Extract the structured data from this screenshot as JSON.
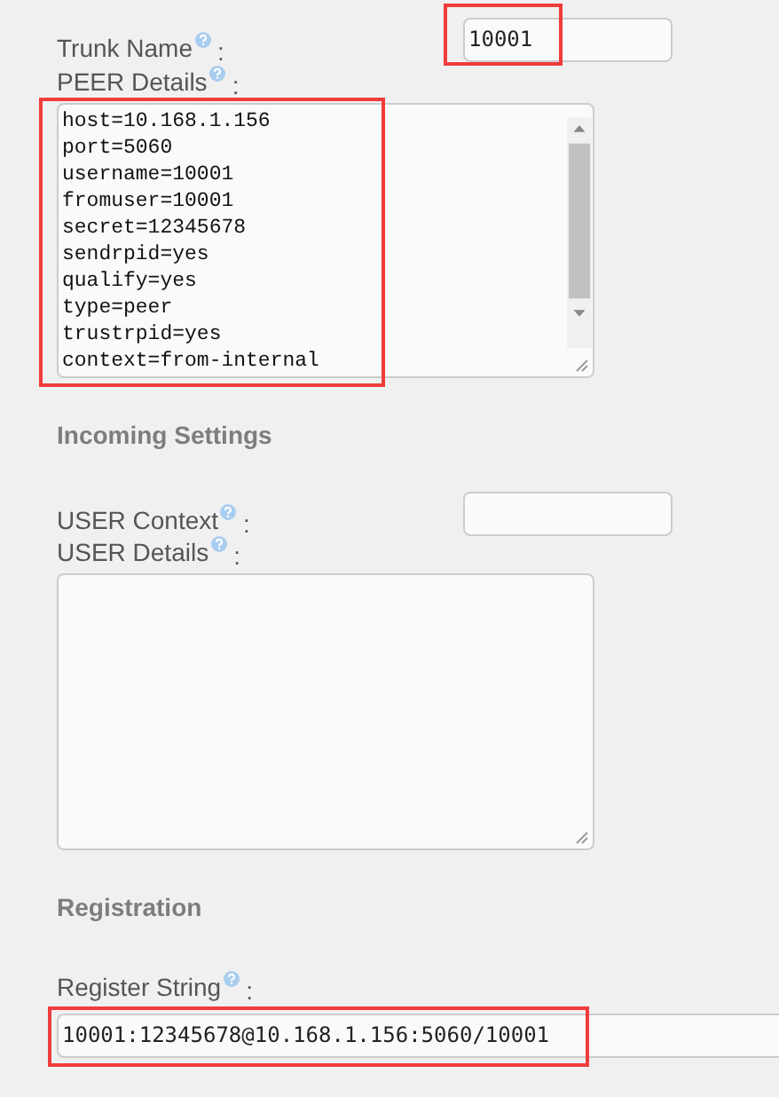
{
  "trunk_name": {
    "label": "Trunk Name",
    "colon": ":",
    "value": "10001",
    "highlighted": true
  },
  "peer_details": {
    "label": "PEER Details",
    "colon": ":",
    "highlighted": true,
    "lines": [
      "host=10.168.1.156",
      "port=5060",
      "username=10001",
      "fromuser=10001",
      "secret=12345678",
      "sendrpid=yes",
      "qualify=yes",
      "type=peer",
      "trustrpid=yes",
      "context=from-internal"
    ]
  },
  "incoming_settings": {
    "heading": "Incoming Settings",
    "user_context": {
      "label": "USER Context",
      "colon": ":"
    },
    "user_details": {
      "label": "USER Details",
      "colon": ":"
    }
  },
  "registration": {
    "heading": "Registration",
    "register_string": {
      "label": "Register String",
      "colon": ":",
      "value": "10001:12345678@10.168.1.156:5060/10001",
      "highlighted": true
    }
  }
}
